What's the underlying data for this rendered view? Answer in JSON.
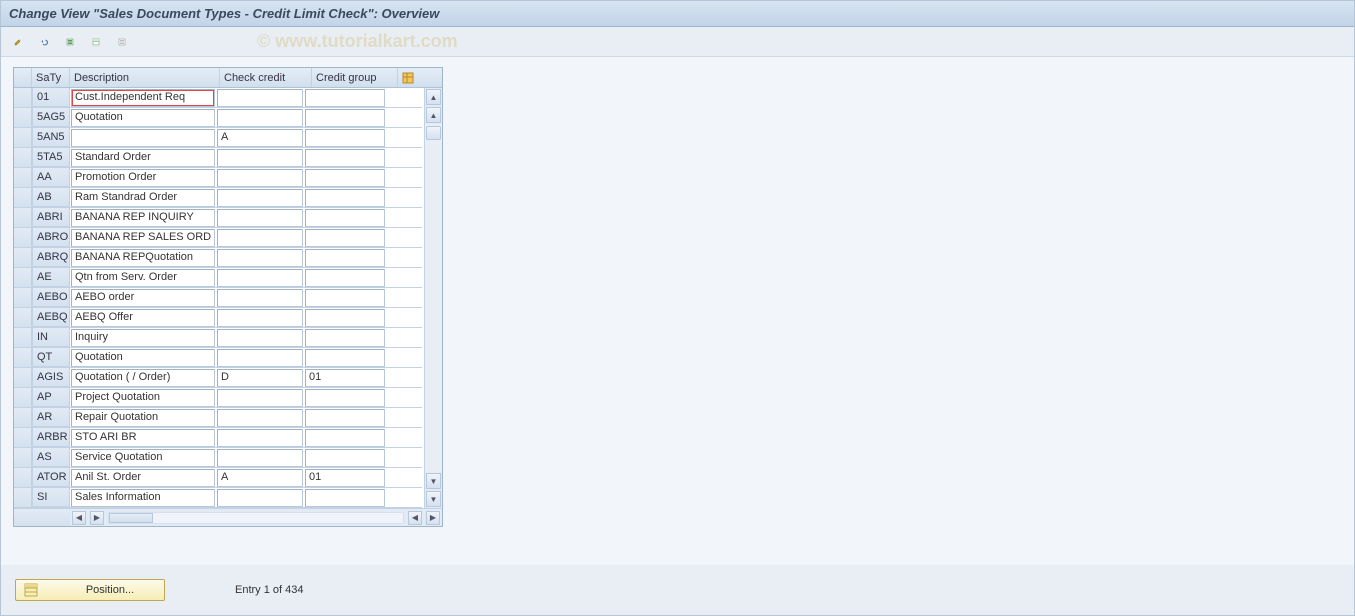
{
  "titlebar": {
    "title": "Change View \"Sales Document Types - Credit Limit Check\": Overview"
  },
  "watermark": "© www.tutorialkart.com",
  "table": {
    "headers": {
      "code": "SaTy",
      "desc": "Description",
      "check": "Check credit",
      "group": "Credit group"
    },
    "rows": [
      {
        "code": "01",
        "desc": "Cust.Independent Req",
        "check": "",
        "group": "",
        "cursor": true
      },
      {
        "code": "5AG5",
        "desc": "Quotation",
        "check": "",
        "group": ""
      },
      {
        "code": "5AN5",
        "desc": "",
        "check": "A",
        "group": ""
      },
      {
        "code": "5TA5",
        "desc": "Standard Order",
        "check": "",
        "group": ""
      },
      {
        "code": "AA",
        "desc": "Promotion Order",
        "check": "",
        "group": ""
      },
      {
        "code": "AB",
        "desc": "Ram Standrad Order",
        "check": "",
        "group": ""
      },
      {
        "code": "ABRI",
        "desc": "BANANA REP INQUIRY",
        "check": "",
        "group": ""
      },
      {
        "code": "ABRO",
        "desc": "BANANA REP SALES ORD",
        "check": "",
        "group": ""
      },
      {
        "code": "ABRQ",
        "desc": "BANANA REPQuotation",
        "check": "",
        "group": ""
      },
      {
        "code": "AE",
        "desc": "Qtn from Serv. Order",
        "check": "",
        "group": ""
      },
      {
        "code": "AEBO",
        "desc": "AEBO order",
        "check": "",
        "group": ""
      },
      {
        "code": "AEBQ",
        "desc": "AEBQ Offer",
        "check": "",
        "group": ""
      },
      {
        "code": "IN",
        "desc": "Inquiry",
        "check": "",
        "group": ""
      },
      {
        "code": "QT",
        "desc": "Quotation",
        "check": "",
        "group": ""
      },
      {
        "code": "AGIS",
        "desc": "Quotation ( / Order)",
        "check": "D",
        "group": "01"
      },
      {
        "code": "AP",
        "desc": "Project Quotation",
        "check": "",
        "group": ""
      },
      {
        "code": "AR",
        "desc": "Repair Quotation",
        "check": "",
        "group": ""
      },
      {
        "code": "ARBR",
        "desc": "STO ARI BR",
        "check": "",
        "group": ""
      },
      {
        "code": "AS",
        "desc": "Service Quotation",
        "check": "",
        "group": ""
      },
      {
        "code": "ATOR",
        "desc": "Anil St. Order",
        "check": "A",
        "group": "01"
      },
      {
        "code": "SI",
        "desc": "Sales Information",
        "check": "",
        "group": ""
      }
    ]
  },
  "footer": {
    "position_button": "Position...",
    "entry_status": "Entry 1 of 434"
  }
}
